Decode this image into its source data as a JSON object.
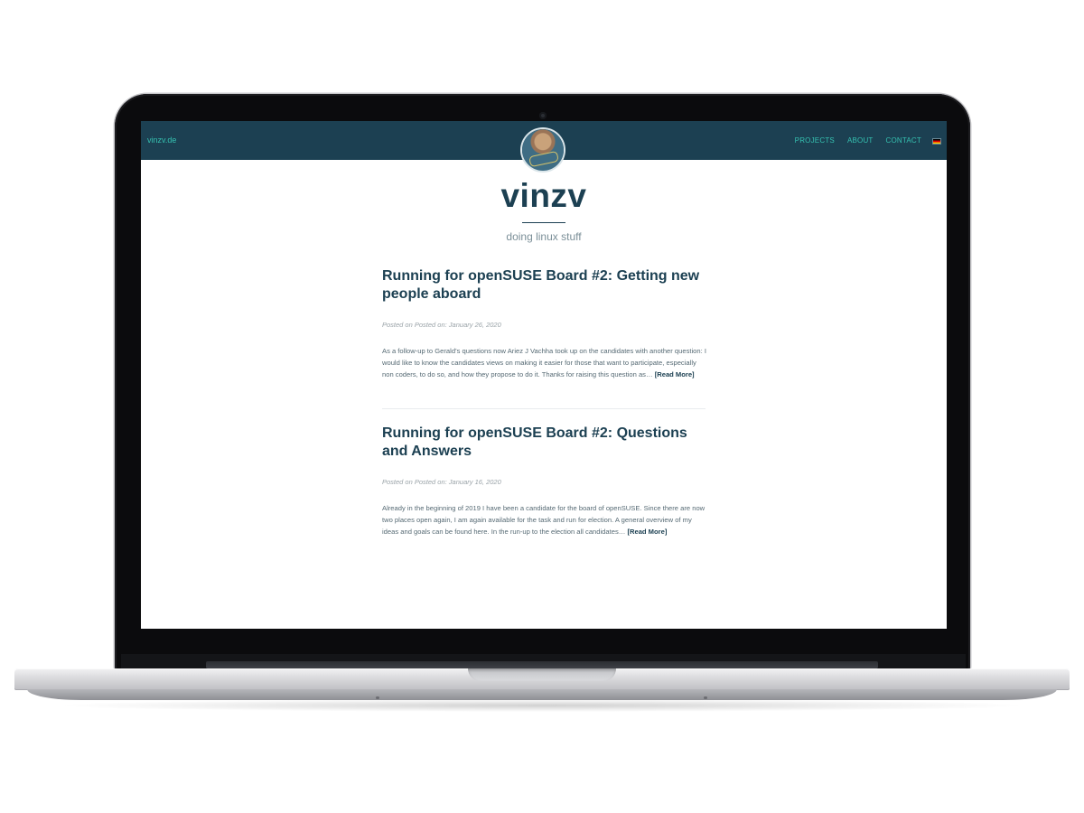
{
  "navbar": {
    "brand": "vinzv.de",
    "links": [
      "PROJECTS",
      "ABOUT",
      "CONTACT"
    ]
  },
  "header": {
    "title": "vinzv",
    "tagline": "doing linux stuff"
  },
  "posts": [
    {
      "title": "Running for openSUSE Board #2: Getting new people aboard",
      "meta": "Posted on Posted on: January 26, 2020",
      "excerpt": "As a follow-up to Gerald’s questions now Ariez J Vachha took up on the candidates with another question: I would like to know the candidates views on making it easier for those that want to participate, especially non coders, to do so, and how they propose to do it. Thanks for raising this question as…",
      "read_more": "[Read More]"
    },
    {
      "title": "Running for openSUSE Board #2: Questions and Answers",
      "meta": "Posted on Posted on: January 16, 2020",
      "excerpt": "Already in the beginning of 2019 I have been a candidate for the board of openSUSE. Since there are now two places open again, I am again available for the task and run for election. A general overview of my ideas and goals can be found here. In the run-up to the election all candidates…",
      "read_more": "[Read More]"
    }
  ],
  "icons": {
    "language_flag": "german-flag-icon",
    "avatar": "profile-avatar"
  },
  "colors": {
    "navbar": "#1c4052",
    "accent": "#35c0b0",
    "heading": "#1c4052"
  }
}
